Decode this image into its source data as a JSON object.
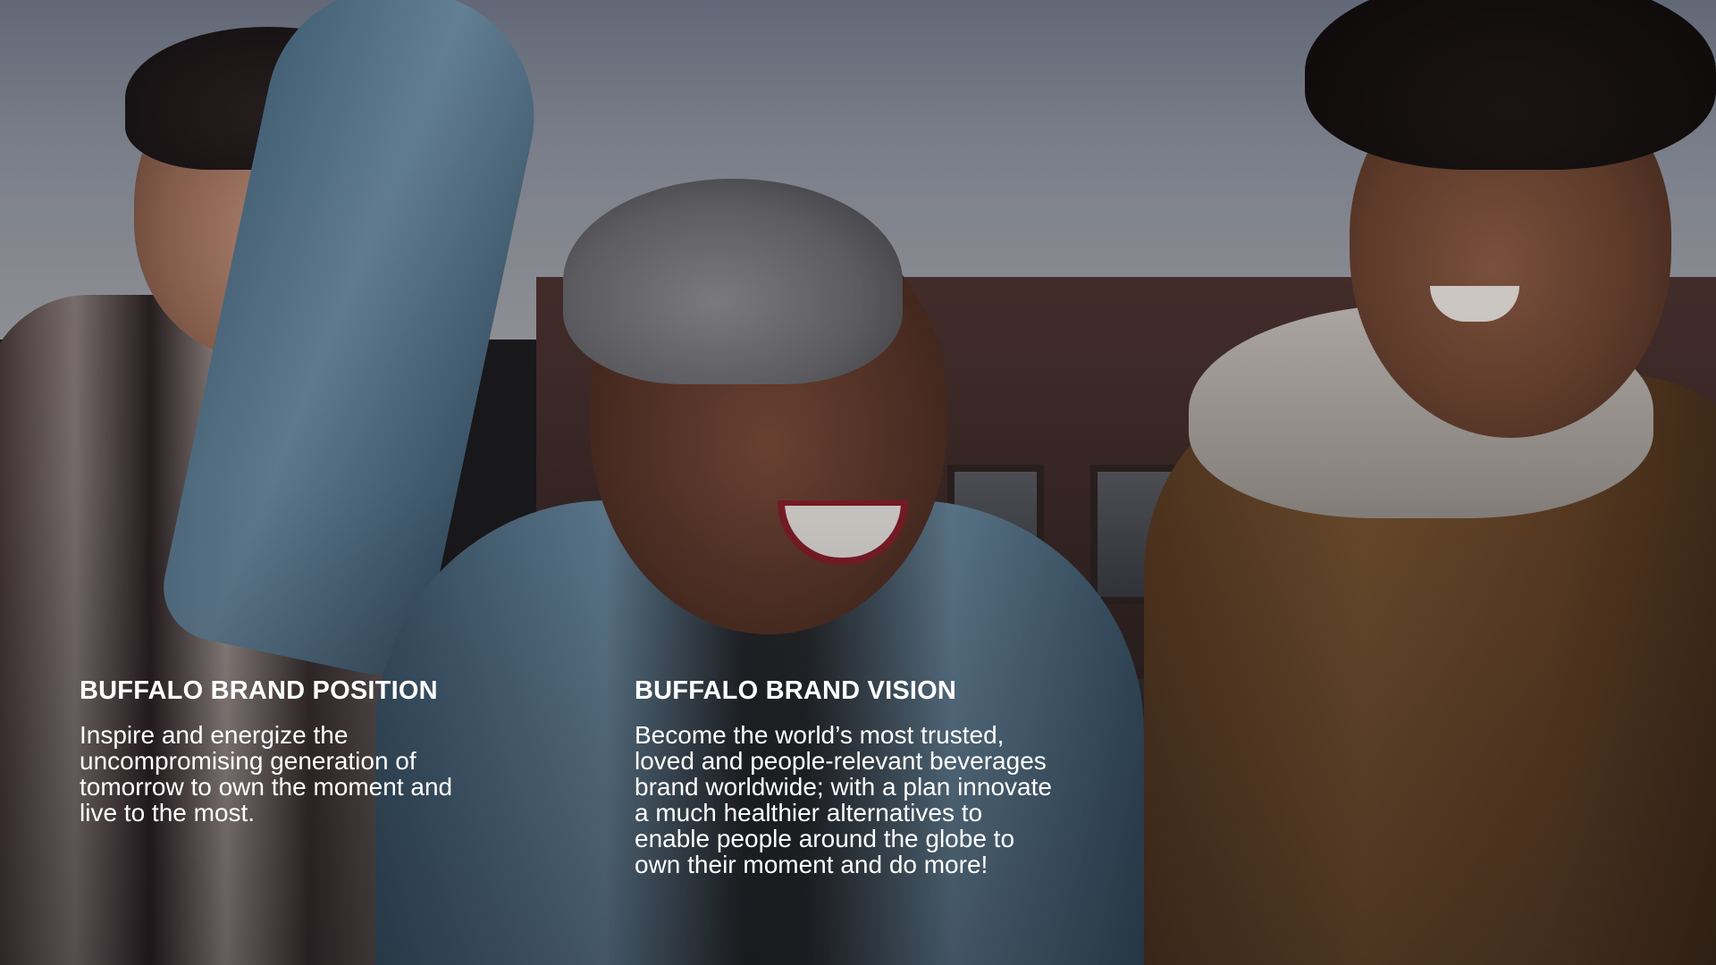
{
  "position": {
    "heading": "BUFFALO BRAND POSITION",
    "body_lines": [
      "Inspire and energize the",
      "uncompromising generation of",
      "tomorrow to own the moment and",
      "live to the most."
    ]
  },
  "vision": {
    "heading": "BUFFALO BRAND VISION",
    "body_lines": [
      "Become the world’s most trusted,",
      "loved and people-relevant beverages",
      "brand worldwide; with a plan innovate",
      "a much healthier alternatives to",
      "enable people around the globe to",
      "own their moment and do more!"
    ]
  },
  "colors": {
    "text": "#ffffff",
    "overlay_dark": "#1b1a1c"
  }
}
